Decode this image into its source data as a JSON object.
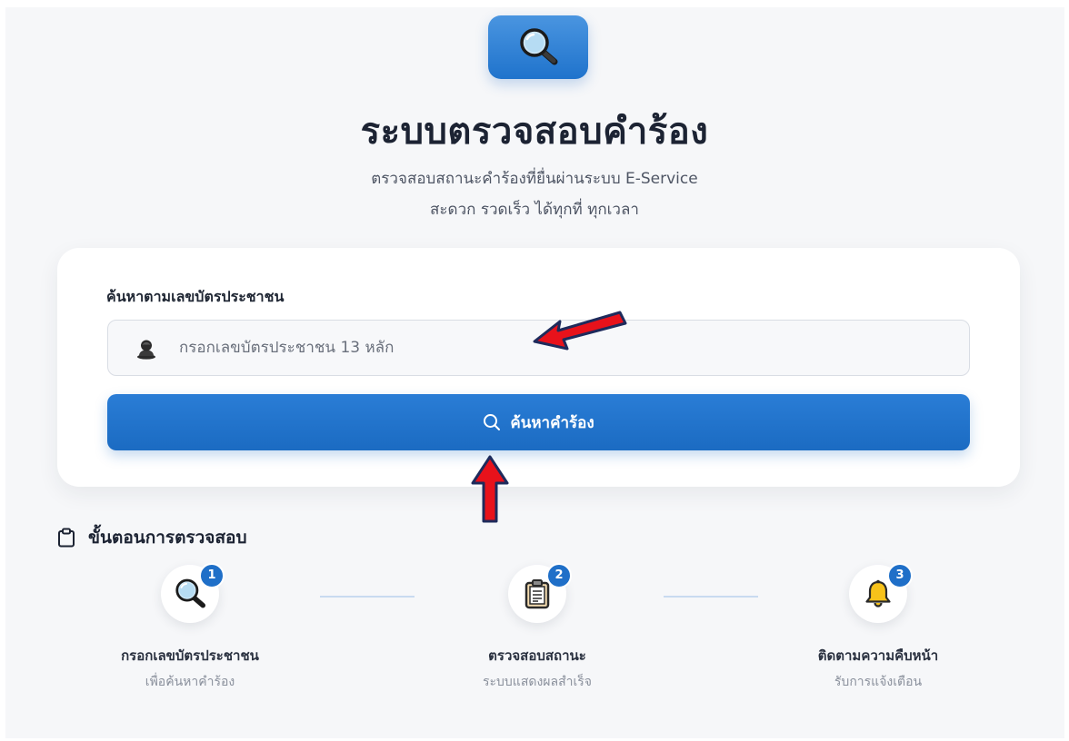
{
  "header": {
    "title": "ระบบตรวจสอบคำร้อง",
    "subtitle_line1": "ตรวจสอบสถานะคำร้องที่ยื่นผ่านระบบ E-Service",
    "subtitle_line2": "สะดวก รวดเร็ว ได้ทุกที่ ทุกเวลา",
    "icon": "magnifier-icon"
  },
  "search": {
    "label": "ค้นหาตามเลขบัตรประชาชน",
    "input_value": "",
    "placeholder": "กรอกเลขบัตรประชาชน 13 หลัก",
    "input_icon": "user-icon",
    "button_label": "ค้นหาคำร้อง",
    "button_icon": "search-icon"
  },
  "steps": {
    "heading": "ขั้นตอนการตรวจสอบ",
    "heading_icon": "clipboard-icon",
    "items": [
      {
        "number": "1",
        "icon": "magnifier-icon",
        "title": "กรอกเลขบัตรประชาชน",
        "desc": "เพื่อค้นหาคำร้อง"
      },
      {
        "number": "2",
        "icon": "clipboard-document-icon",
        "title": "ตรวจสอบสถานะ",
        "desc": "ระบบแสดงผลสำเร็จ"
      },
      {
        "number": "3",
        "icon": "bell-icon",
        "title": "ติดตามความคืบหน้า",
        "desc": "รับการแจ้งเตือน"
      }
    ]
  },
  "colors": {
    "primary": "#1f6fc8",
    "annotation_arrow": "#e8121b",
    "annotation_outline": "#1e2b5c"
  }
}
